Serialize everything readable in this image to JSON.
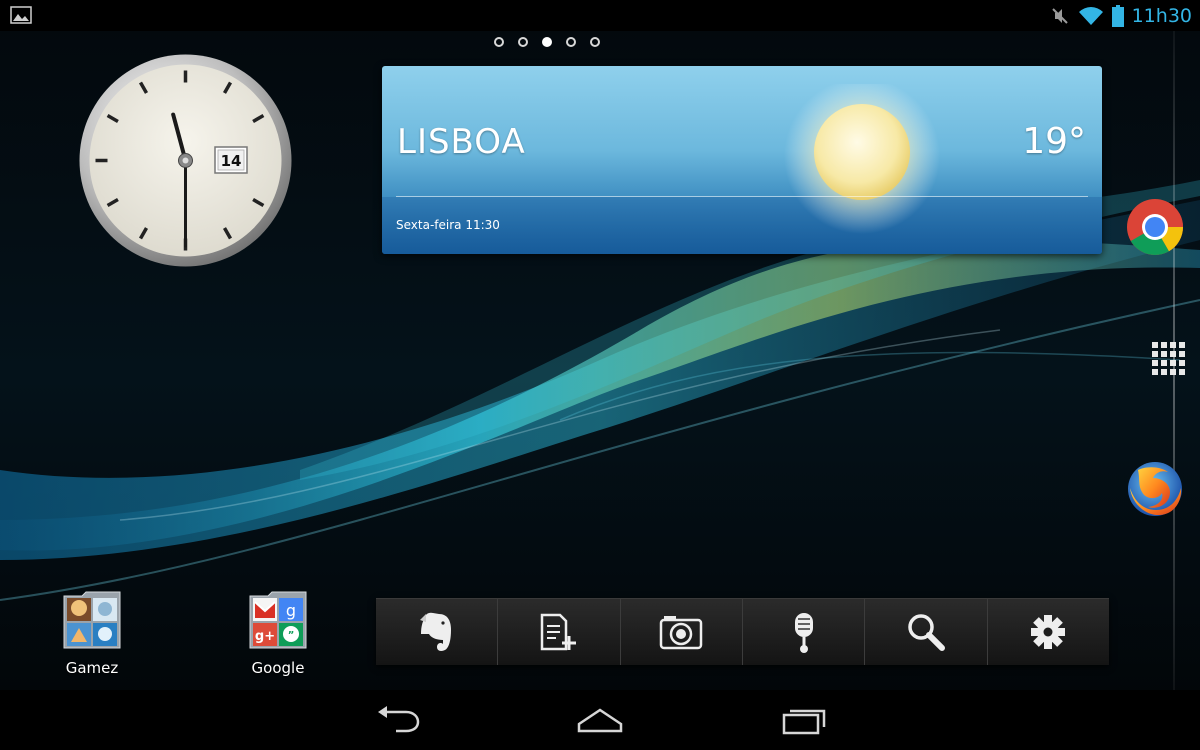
{
  "status_bar": {
    "time": "11h30",
    "icons": [
      "gallery-icon",
      "mute-icon",
      "wifi-icon",
      "battery-icon"
    ],
    "accent_color": "#33b5e5"
  },
  "home_pages": {
    "count": 5,
    "active_index": 2
  },
  "clock_widget": {
    "hour": 11,
    "minute": 30,
    "date": "14"
  },
  "weather_widget": {
    "city": "LISBOA",
    "temperature": "19°",
    "datetime": "Sexta-feira 11:30",
    "condition_icon": "sun-icon"
  },
  "dock": {
    "items": [
      "chrome-icon",
      "app-drawer-icon",
      "firefox-icon"
    ]
  },
  "folders": [
    {
      "label": "Gamez"
    },
    {
      "label": "Google"
    }
  ],
  "quick_actions": [
    "evernote-icon",
    "new-note-icon",
    "camera-icon",
    "voice-memo-icon",
    "search-icon",
    "settings-icon"
  ],
  "nav_bar": {
    "buttons": [
      "back-icon",
      "home-icon",
      "recent-apps-icon"
    ]
  }
}
